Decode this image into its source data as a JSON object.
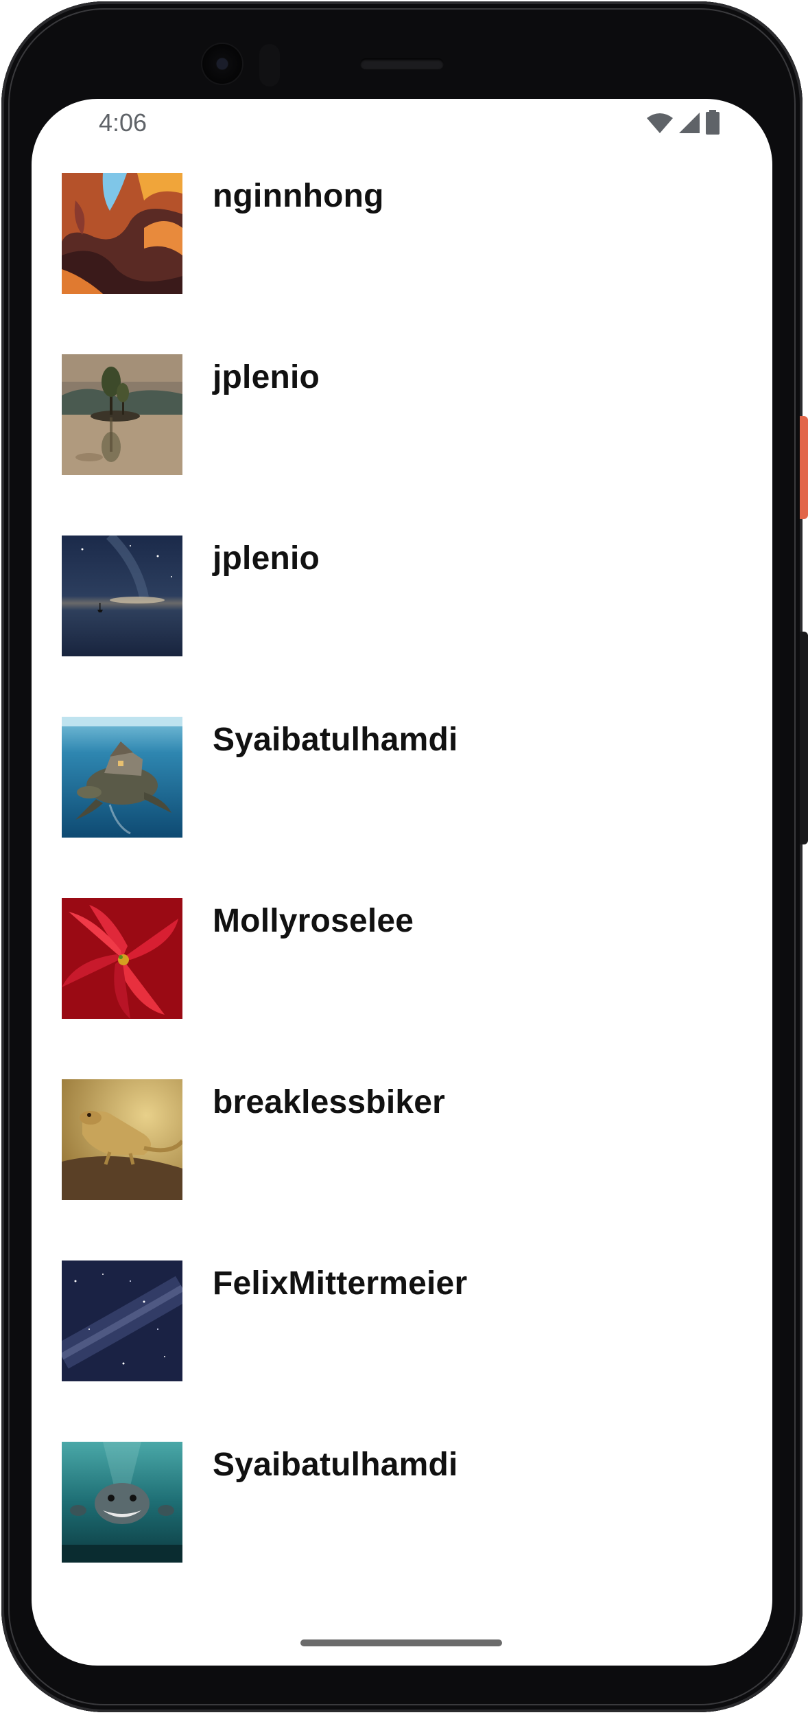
{
  "status_bar": {
    "time": "4:06",
    "icons": [
      "wifi-icon",
      "cellular-signal-icon",
      "battery-icon"
    ]
  },
  "feed": {
    "items": [
      {
        "username": "nginnhong",
        "thumbnail": "canyon-photo"
      },
      {
        "username": "jplenio",
        "thumbnail": "tree-island-reflection-photo"
      },
      {
        "username": "jplenio",
        "thumbnail": "night-sky-lake-photo"
      },
      {
        "username": "Syaibatulhamdi",
        "thumbnail": "turtle-house-underwater-photo"
      },
      {
        "username": "Mollyroselee",
        "thumbnail": "red-poinsettia-photo"
      },
      {
        "username": "breaklessbiker",
        "thumbnail": "lizard-photo"
      },
      {
        "username": "FelixMittermeier",
        "thumbnail": "milky-way-photo"
      },
      {
        "username": "Syaibatulhamdi",
        "thumbnail": "shark-underwater-photo"
      }
    ]
  },
  "colors": {
    "background": "#ffffff",
    "text": "#111111",
    "status_text": "#5f6368",
    "device_frame": "#0c0c0e",
    "accent_button": "#e2664a"
  }
}
